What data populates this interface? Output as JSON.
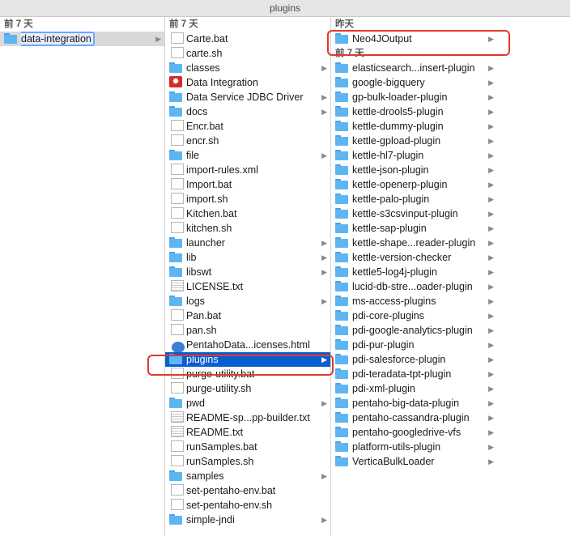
{
  "window": {
    "title": "plugins"
  },
  "column1": {
    "header": "前 7 天",
    "items": [
      {
        "label": "data-integration",
        "kind": "folder",
        "expandable": true,
        "selected": "grey"
      }
    ]
  },
  "column2": {
    "header": "前 7 天",
    "items": [
      {
        "label": "Carte.bat",
        "kind": "file"
      },
      {
        "label": "carte.sh",
        "kind": "file"
      },
      {
        "label": "classes",
        "kind": "folder",
        "expandable": true
      },
      {
        "label": "Data Integration",
        "kind": "app"
      },
      {
        "label": "Data Service JDBC Driver",
        "kind": "folder",
        "expandable": true
      },
      {
        "label": "docs",
        "kind": "folder",
        "expandable": true
      },
      {
        "label": "Encr.bat",
        "kind": "file"
      },
      {
        "label": "encr.sh",
        "kind": "file"
      },
      {
        "label": "file",
        "kind": "folder",
        "expandable": true
      },
      {
        "label": "import-rules.xml",
        "kind": "file"
      },
      {
        "label": "Import.bat",
        "kind": "file"
      },
      {
        "label": "import.sh",
        "kind": "file"
      },
      {
        "label": "Kitchen.bat",
        "kind": "file"
      },
      {
        "label": "kitchen.sh",
        "kind": "file"
      },
      {
        "label": "launcher",
        "kind": "folder",
        "expandable": true
      },
      {
        "label": "lib",
        "kind": "folder",
        "expandable": true
      },
      {
        "label": "libswt",
        "kind": "folder",
        "expandable": true
      },
      {
        "label": "LICENSE.txt",
        "kind": "doc"
      },
      {
        "label": "logs",
        "kind": "folder",
        "expandable": true
      },
      {
        "label": "Pan.bat",
        "kind": "file"
      },
      {
        "label": "pan.sh",
        "kind": "file"
      },
      {
        "label": "PentahoData...icenses.html",
        "kind": "globe"
      },
      {
        "label": "plugins",
        "kind": "folder",
        "expandable": true,
        "selected": "blue"
      },
      {
        "label": "purge-utility.bat",
        "kind": "file"
      },
      {
        "label": "purge-utility.sh",
        "kind": "file"
      },
      {
        "label": "pwd",
        "kind": "folder",
        "expandable": true
      },
      {
        "label": "README-sp...pp-builder.txt",
        "kind": "doc"
      },
      {
        "label": "README.txt",
        "kind": "doc"
      },
      {
        "label": "runSamples.bat",
        "kind": "file"
      },
      {
        "label": "runSamples.sh",
        "kind": "file"
      },
      {
        "label": "samples",
        "kind": "folder",
        "expandable": true
      },
      {
        "label": "set-pentaho-env.bat",
        "kind": "file"
      },
      {
        "label": "set-pentaho-env.sh",
        "kind": "file"
      },
      {
        "label": "simple-jndi",
        "kind": "folder",
        "expandable": true
      }
    ]
  },
  "column3": {
    "header": "昨天",
    "top_items": [
      {
        "label": "Neo4JOutput",
        "kind": "folder",
        "expandable": true
      }
    ],
    "subheader": "前 7 天",
    "items": [
      {
        "label": "elasticsearch...insert-plugin",
        "kind": "folder",
        "expandable": true
      },
      {
        "label": "google-bigquery",
        "kind": "folder",
        "expandable": true
      },
      {
        "label": "gp-bulk-loader-plugin",
        "kind": "folder",
        "expandable": true
      },
      {
        "label": "kettle-drools5-plugin",
        "kind": "folder",
        "expandable": true
      },
      {
        "label": "kettle-dummy-plugin",
        "kind": "folder",
        "expandable": true
      },
      {
        "label": "kettle-gpload-plugin",
        "kind": "folder",
        "expandable": true
      },
      {
        "label": "kettle-hl7-plugin",
        "kind": "folder",
        "expandable": true
      },
      {
        "label": "kettle-json-plugin",
        "kind": "folder",
        "expandable": true
      },
      {
        "label": "kettle-openerp-plugin",
        "kind": "folder",
        "expandable": true
      },
      {
        "label": "kettle-palo-plugin",
        "kind": "folder",
        "expandable": true
      },
      {
        "label": "kettle-s3csvinput-plugin",
        "kind": "folder",
        "expandable": true
      },
      {
        "label": "kettle-sap-plugin",
        "kind": "folder",
        "expandable": true
      },
      {
        "label": "kettle-shape...reader-plugin",
        "kind": "folder",
        "expandable": true
      },
      {
        "label": "kettle-version-checker",
        "kind": "folder",
        "expandable": true
      },
      {
        "label": "kettle5-log4j-plugin",
        "kind": "folder",
        "expandable": true
      },
      {
        "label": "lucid-db-stre...oader-plugin",
        "kind": "folder",
        "expandable": true
      },
      {
        "label": "ms-access-plugins",
        "kind": "folder",
        "expandable": true
      },
      {
        "label": "pdi-core-plugins",
        "kind": "folder",
        "expandable": true
      },
      {
        "label": "pdi-google-analytics-plugin",
        "kind": "folder",
        "expandable": true
      },
      {
        "label": "pdi-pur-plugin",
        "kind": "folder",
        "expandable": true
      },
      {
        "label": "pdi-salesforce-plugin",
        "kind": "folder",
        "expandable": true
      },
      {
        "label": "pdi-teradata-tpt-plugin",
        "kind": "folder",
        "expandable": true
      },
      {
        "label": "pdi-xml-plugin",
        "kind": "folder",
        "expandable": true
      },
      {
        "label": "pentaho-big-data-plugin",
        "kind": "folder",
        "expandable": true
      },
      {
        "label": "pentaho-cassandra-plugin",
        "kind": "folder",
        "expandable": true
      },
      {
        "label": "pentaho-googledrive-vfs",
        "kind": "folder",
        "expandable": true
      },
      {
        "label": "platform-utils-plugin",
        "kind": "folder",
        "expandable": true
      },
      {
        "label": "VerticaBulkLoader",
        "kind": "folder",
        "expandable": true
      }
    ]
  },
  "colors": {
    "selection_blue": "#0a5fd0",
    "selection_grey": "#d9d9d9",
    "annotation_red": "#e0392b",
    "folder_blue": "#5db6f2"
  }
}
